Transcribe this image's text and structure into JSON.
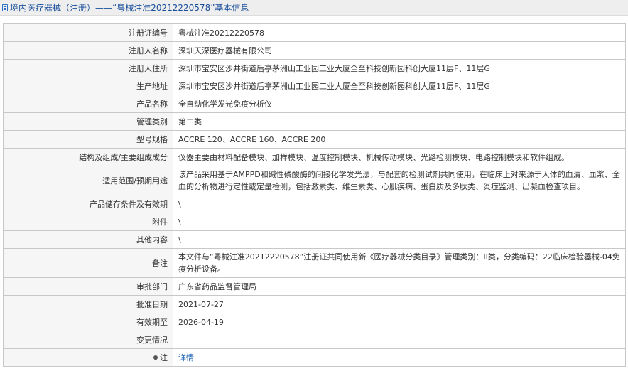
{
  "header": {
    "icon": "document-icon",
    "title": "境内医疗器械（注册）——“粤械注准20212220578”基本信息"
  },
  "rows": [
    {
      "label": "注册证编号",
      "value": "粤械注准20212220578"
    },
    {
      "label": "注册人名称",
      "value": "深圳天深医疗器械有限公司"
    },
    {
      "label": "注册人住所",
      "value": "深圳市宝安区沙井街道后亭茅洲山工业园工业大厦全至科技创新园科创大厦11层F、11层G"
    },
    {
      "label": "生产地址",
      "value": "深圳市宝安区沙井街道后亭茅洲山工业园工业大厦全至科技创新园科创大厦11层F、11层G"
    },
    {
      "label": "产品名称",
      "value": "全自动化学发光免疫分析仪"
    },
    {
      "label": "管理类别",
      "value": "第二类"
    },
    {
      "label": "型号规格",
      "value": "ACCRE 120、ACCRE 160、ACCRE 200"
    },
    {
      "label": "结构及组成/主要组成成分",
      "value": "仪器主要由材料配备模块、加样模块、温度控制模块、机械传动模块、光路检测模块、电路控制模块和软件组成。"
    },
    {
      "label": "适用范围/预期用途",
      "value": "该产品采用基于AMPPD和碱性磷酸酶的间接化学发光法，与配套的检测试剂共同使用，在临床上对来源于人体的血清、血浆、全血的分析物进行定性或定量检测，包括激素类、维生素类、心肌疾病、蛋白质及多肽类、炎症监测、出凝血检查项目。"
    },
    {
      "label": "产品储存条件及有效期",
      "value": "\\"
    },
    {
      "label": "附件",
      "value": "\\"
    },
    {
      "label": "其他内容",
      "value": "\\"
    },
    {
      "label": "备注",
      "value": "本文件与“粤械注准20212220578”注册证共同使用新《医疗器械分类目录》管理类别：II类，分类编码：22临床检验器械-04免疫分析设备。"
    },
    {
      "label": "审批部门",
      "value": "广东省药品监督管理局"
    },
    {
      "label": "批准日期",
      "value": "2021-07-27"
    },
    {
      "label": "有效期至",
      "value": "2026-04-19"
    },
    {
      "label": "变更情况",
      "value": ""
    }
  ],
  "note": {
    "icon": "pin-icon",
    "label": "注",
    "link": "详情"
  }
}
